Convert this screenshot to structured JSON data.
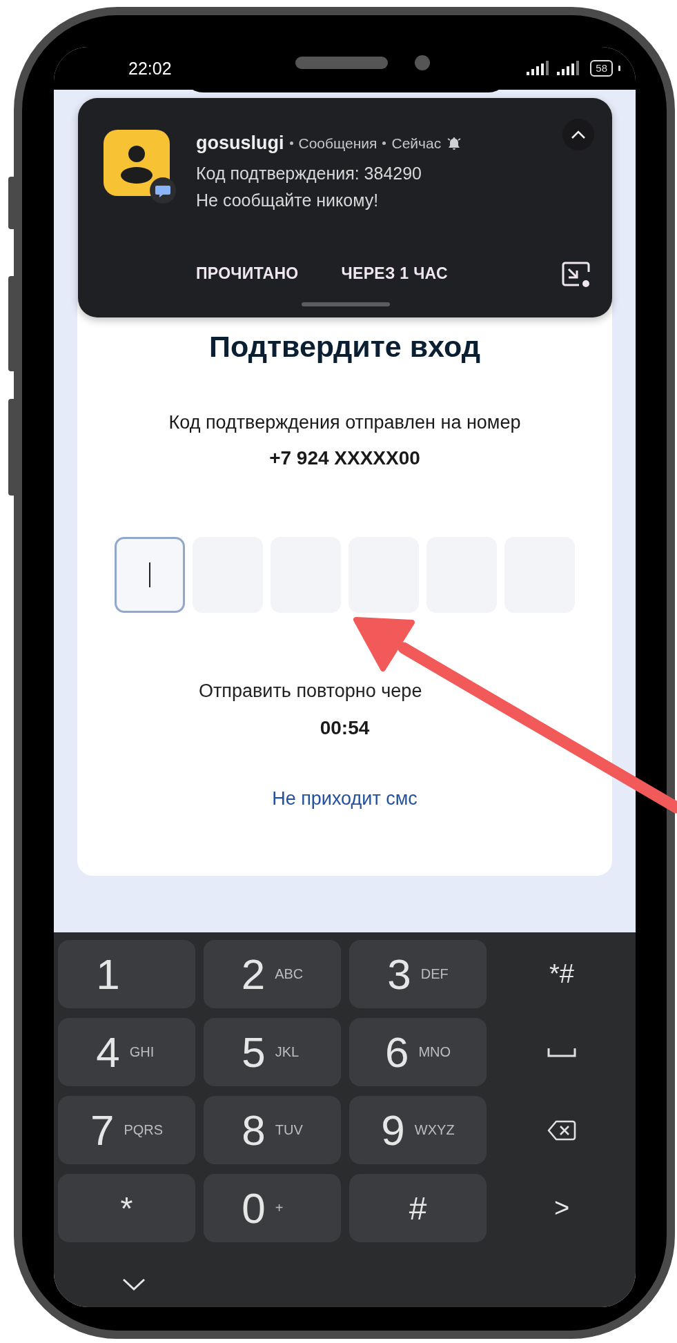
{
  "status_bar": {
    "time": "22:02",
    "battery": "58"
  },
  "notification": {
    "app": "gosuslugi",
    "source": "Сообщения",
    "when": "Сейчас",
    "title": "Код подтверждения: 384290",
    "body": "Не сообщайте никому!",
    "actions": [
      "ПРОЧИТАНО",
      "ЧЕРЕЗ 1 ЧАС"
    ]
  },
  "page": {
    "title": "Подтвердите вход",
    "message": "Код подтверждения отправлен на номер",
    "phone": "+7 924 XXXXX00",
    "code_cells": [
      {
        "focused": true
      },
      {
        "focused": false
      },
      {
        "focused": false
      },
      {
        "focused": false
      },
      {
        "focused": false
      },
      {
        "focused": false
      }
    ],
    "resend": "Отправить повторно чере",
    "timer": "00:54",
    "link": "Не приходит смс"
  },
  "keyboard": {
    "keys": [
      {
        "kind": "key",
        "main": "1"
      },
      {
        "kind": "key",
        "main": "2",
        "letters": "ABC"
      },
      {
        "kind": "key",
        "main": "3",
        "letters": "DEF"
      },
      {
        "kind": "action",
        "main": "*#"
      },
      {
        "kind": "key",
        "main": "4",
        "letters": "GHI"
      },
      {
        "kind": "key",
        "main": "5",
        "letters": "JKL"
      },
      {
        "kind": "key",
        "main": "6",
        "letters": "MNO"
      },
      {
        "kind": "space"
      },
      {
        "kind": "key",
        "main": "7",
        "letters": "PQRS"
      },
      {
        "kind": "key",
        "main": "8",
        "letters": "TUV"
      },
      {
        "kind": "key",
        "main": "9",
        "letters": "WXYZ"
      },
      {
        "kind": "backspace"
      },
      {
        "kind": "key",
        "main": "*"
      },
      {
        "kind": "key",
        "main": "0",
        "letters": "+"
      },
      {
        "kind": "key",
        "main": "#"
      },
      {
        "kind": "action",
        "main": ">"
      }
    ]
  }
}
